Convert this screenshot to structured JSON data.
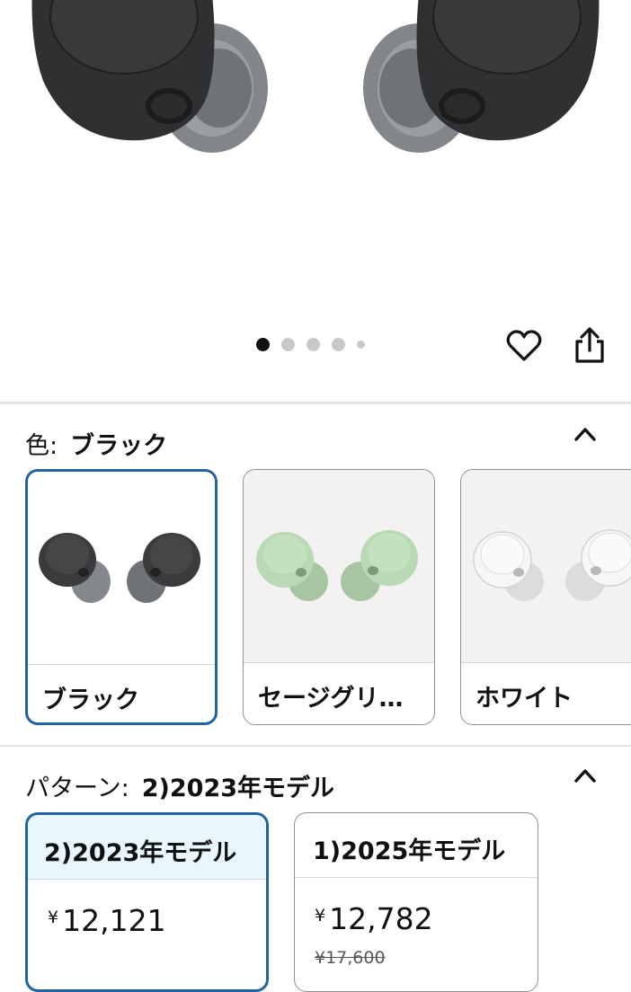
{
  "gallery": {
    "image_alt": "ブラック",
    "dot_count": 5,
    "active_dot": 0
  },
  "actions": {
    "favorite_icon": "heart-icon",
    "share_icon": "share-icon"
  },
  "color_section": {
    "key": "色:",
    "value": "ブラック",
    "collapse_icon": "chevron-up-icon",
    "options": [
      {
        "label": "ブラック",
        "color": "#3a3b3d",
        "selected": true
      },
      {
        "label": "セージグリ…",
        "color": "#b9d9b4",
        "selected": false
      },
      {
        "label": "ホワイト",
        "color": "#ececec",
        "selected": false
      }
    ]
  },
  "pattern_section": {
    "key": "パターン:",
    "value": "2)2023年モデル",
    "collapse_icon": "chevron-up-icon",
    "options": [
      {
        "label": "2)2023年モデル",
        "currency": "¥",
        "price": "12,121",
        "selected": true
      },
      {
        "label": "1)2025年モデル",
        "currency": "¥",
        "price": "12,782",
        "list_price": "¥17,600",
        "selected": false
      }
    ]
  },
  "colors": {
    "accent": "#2162a1",
    "selected_header_bg": "#eaf6fe"
  }
}
